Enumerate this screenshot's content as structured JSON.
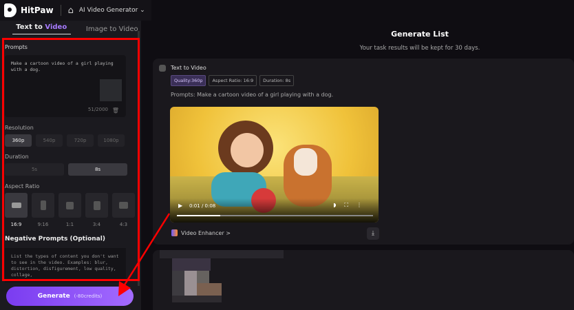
{
  "header": {
    "brand": "HitPaw",
    "home_icon": "home-icon",
    "module": "AI Video Generator"
  },
  "sidebar": {
    "tabs": [
      {
        "label_a": "Text to ",
        "label_b": "Video",
        "active": true
      },
      {
        "label": "Image to Video"
      }
    ],
    "prompts_label": "Prompts",
    "prompt_value": "Make a cartoon video of a girl playing with a dog.",
    "char_count": "51/2000",
    "resolution_label": "Resolution",
    "resolutions": [
      {
        "label": "360p",
        "selected": true
      },
      {
        "label": "540p"
      },
      {
        "label": "720p"
      },
      {
        "label": "1080p"
      }
    ],
    "duration_label": "Duration",
    "durations": [
      {
        "label": "5s"
      },
      {
        "label": "8s",
        "selected": true
      }
    ],
    "aspect_label": "Aspect Ratio",
    "aspects": [
      {
        "label": "16:9",
        "selected": true
      },
      {
        "label": "9:16"
      },
      {
        "label": "1:1"
      },
      {
        "label": "3:4"
      },
      {
        "label": "4:3"
      }
    ],
    "negative_label": "Negative Prompts (Optional)",
    "negative_placeholder": "List the types of content you don't want to see in the video. Examples: blur, distortion, disfigurement, low quality, collage,",
    "generate_label": "Generate",
    "generate_credits": "(-80credits)"
  },
  "main": {
    "title": "Generate List",
    "subtitle": "Your task results will be kept for 30 days.",
    "card": {
      "type": "Text to Video",
      "tags": [
        "Quality:360p",
        "Aspect Ratio: 16:9",
        "Duration: 8s"
      ],
      "prompt": "Prompts:  Make a cartoon video of a girl playing with a dog.",
      "video_time": "0:01 / 0:08",
      "progress": 0.22,
      "enhancer": "Video Enhancer >"
    }
  },
  "colors": {
    "accent": "#8b4dff",
    "annotation": "#ff0000"
  }
}
